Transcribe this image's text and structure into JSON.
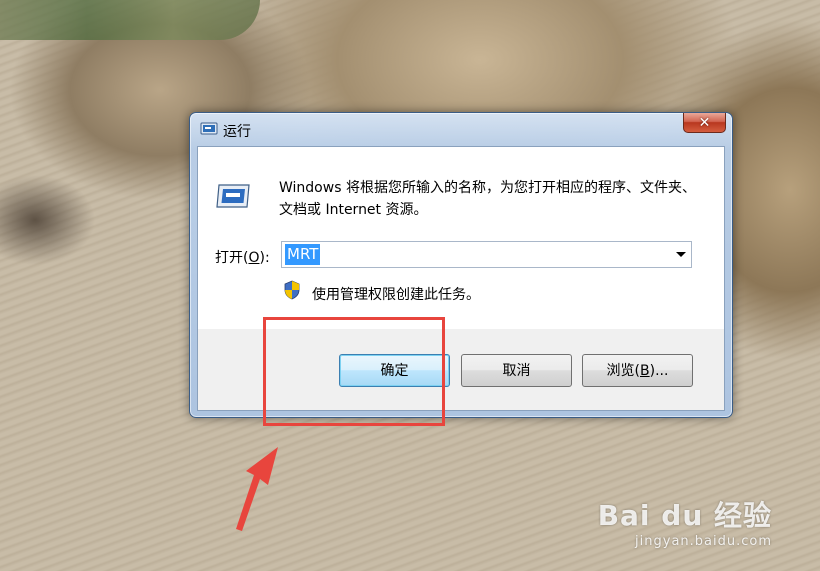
{
  "window": {
    "title": "运行",
    "close_glyph": "✕",
    "description": "Windows 将根据您所输入的名称，为您打开相应的程序、文件夹、文档或 Internet 资源。",
    "open_label_prefix": "打开(",
    "open_label_key": "O",
    "open_label_suffix": "):",
    "open_value": "MRT",
    "admin_text": "使用管理权限创建此任务。",
    "buttons": {
      "ok": "确定",
      "cancel": "取消",
      "browse_prefix": "浏览(",
      "browse_key": "B",
      "browse_suffix": ")..."
    }
  },
  "watermark": {
    "brand": "Bai du 经验",
    "url": "jingyan.baidu.com"
  },
  "colors": {
    "highlight": "#e8453d",
    "selection": "#3399ff",
    "window_frame": "#b9cfe9"
  },
  "icons": [
    "run-program-icon",
    "uac-shield-icon",
    "close-icon",
    "dropdown-arrow-icon"
  ]
}
